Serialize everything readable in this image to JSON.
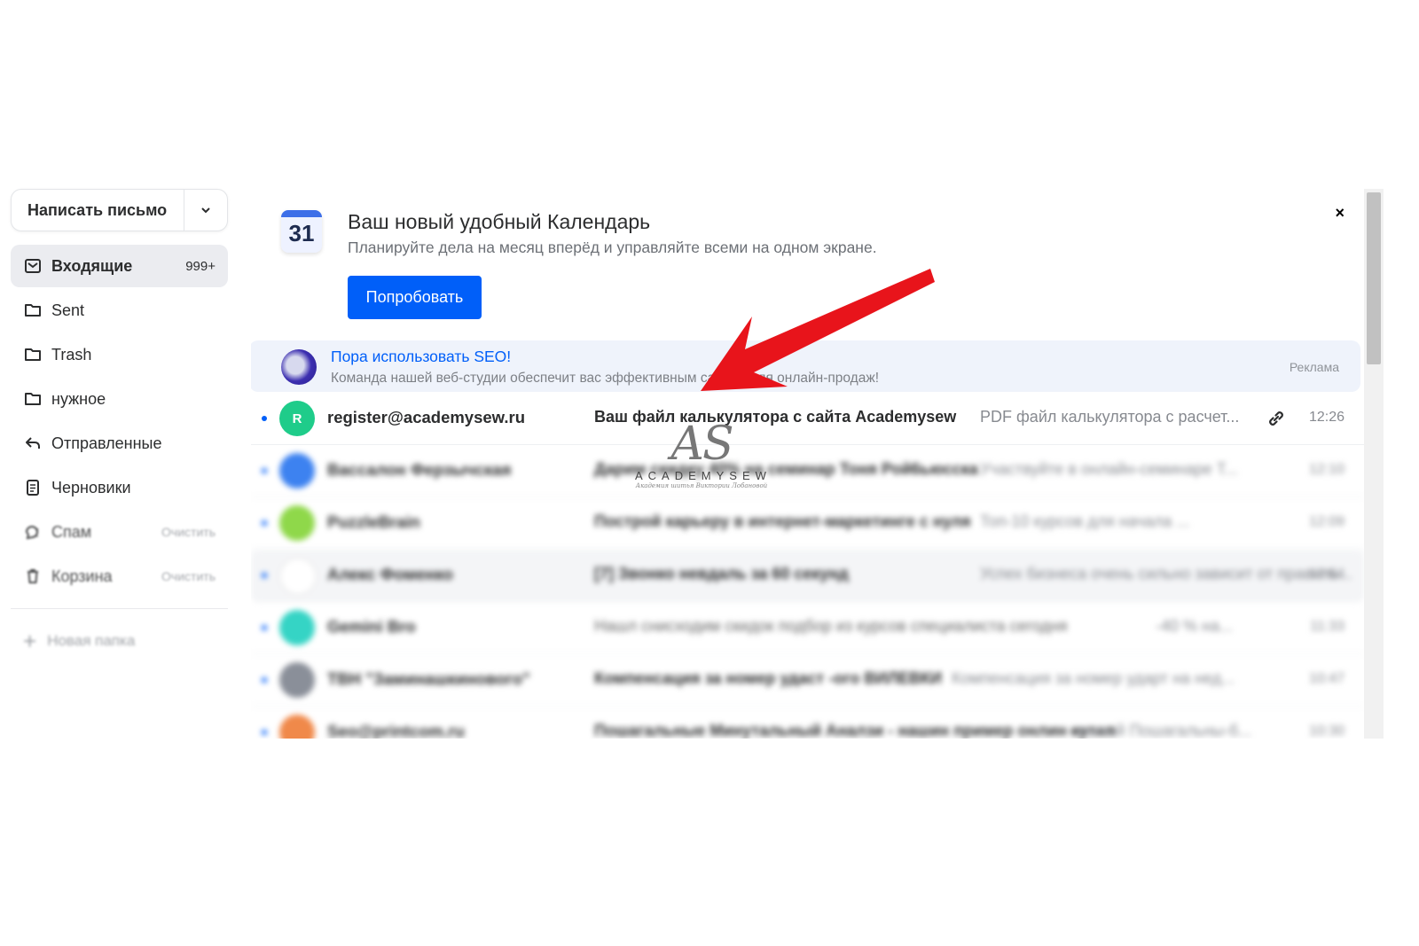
{
  "compose": {
    "label": "Написать письмо"
  },
  "folders": [
    {
      "label": "Входящие",
      "count": "999+"
    },
    {
      "label": "Sent"
    },
    {
      "label": "Trash"
    },
    {
      "label": "нужное"
    },
    {
      "label": "Отправленные"
    },
    {
      "label": "Черновики"
    },
    {
      "label": "Спам",
      "action": "Очистить"
    },
    {
      "label": "Корзина",
      "action": "Очистить"
    }
  ],
  "new_folder": {
    "label": "Новая папка"
  },
  "promo": {
    "icon_number": "31",
    "title": "Ваш новый удобный Календарь",
    "subtitle": "Планируйте дела на месяц вперёд и управляйте всеми на одном экране.",
    "button": "Попробовать",
    "close": "×"
  },
  "ad": {
    "title": "Пора использовать SEO!",
    "text": "Команда нашей веб-студии обеспечит вас эффективным сайтом для онлайн-продаж!",
    "label": "Реклама"
  },
  "messages": [
    {
      "initial": "R",
      "sender": "register@academysew.ru",
      "subject": "Ваш файл калькулятора с сайта Academysew",
      "snippet": "PDF файл калькулятора с расчет...",
      "time": "12:26",
      "color": "#1fcc8a"
    },
    {
      "initial": "",
      "sender": "Вассалон Ферзычская",
      "subject": "Дарим скидку 40% на семинар Тоня Рой6ьюсска",
      "snippet": "Участвуйте в онлайн-семинаре Т...",
      "time": "12:10",
      "color": "#3d82f0"
    },
    {
      "initial": "",
      "sender": "PuzzleBrain",
      "subject": "Построй карьеру в интернет-маркетинге с нуля",
      "snippet": "Топ-10 курсов для начала ...",
      "time": "12:09",
      "color": "#8fd84a"
    },
    {
      "initial": "",
      "sender": "Алекс Фоменко",
      "subject": "[7] Звонко невдаль за 60 секунд",
      "snippet": "Успех бизнеса очень сильно зависит от правиль...",
      "time": "12:04",
      "color": "#ffffff"
    },
    {
      "initial": "",
      "sender": "Gemini Bro",
      "subject": "Нашл снисходим скидок подбор из курсов специалиста сегодня",
      "snippet": "-40 % на...",
      "time": "11:33",
      "color": "#35d4c5"
    },
    {
      "initial": "",
      "sender": "ТВН \"Заминашкинового\"",
      "subject": "Компенсация за номер удаст -ого ВИЛЕВКИ",
      "snippet": "Компенсация за номер ударт на нед...",
      "time": "10:47",
      "color": "#8a8f99"
    },
    {
      "initial": "",
      "sender": "Seo@printcom.ru",
      "subject": "Пошагальные Минутальный Аналзи - нашин пример онлин кутал",
      "snippet": "- выхый Пошагальны-б...",
      "time": "10:30",
      "color": "#f0894a"
    }
  ],
  "watermark": {
    "logo": "AS",
    "text": "ACADEMYSEW",
    "tagline": "Академия шитья Виктории Лобановой"
  },
  "colors": {
    "accent": "#005ff9",
    "arrow": "#e8141b",
    "active_bg": "#ebecf0",
    "ad_bg": "#eff3fb"
  }
}
